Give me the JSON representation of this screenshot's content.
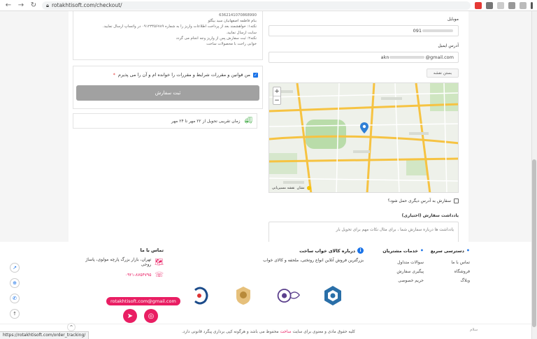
{
  "browser": {
    "url": "rotakhtisoft.com/checkout/"
  },
  "bank_info": {
    "lines": [
      "6362141070868990",
      "بنام فاطمه اصفهانیان سید بیگلو",
      "نکته۱: خواهشمند بعد از پرداخت اطلاعات واریز را به شماره ۰۹۱۲۳۴۵۶۷۸۹ در واتساپ ارسال نمایید.",
      "سایت ارسال نمایید.",
      "نکته۲: ثبت سفارش پس از واریز وجه انجام می گردد",
      "خوابی راحت با محصولات ساخت"
    ]
  },
  "terms": {
    "label": "من قوانین و مقررات شرایط و مقررات را خوانده ام و آن را می پذیرم",
    "required": "*",
    "order_button": "ثبت سفارش"
  },
  "delivery": {
    "text": "زمان تقریبی تحویل از ۲۲ مهر تا ۲۴ مهر"
  },
  "form": {
    "mobile_label": "موبایل",
    "mobile_value": "091",
    "email_label": "آدرس ایمیل",
    "email_prefix": "akn",
    "email_suffix": "@gmail.com",
    "close_map": "بستن نقشه",
    "map_credit": "نشان",
    "map_credit_sub": "نقشه مسیریابی",
    "zoom_in": "+",
    "zoom_out": "−",
    "other_address": "سفارش به آدرس دیگری حمل شود؟",
    "note_label": "یادداشت سفارش (اختیاری)",
    "note_placeholder": "یادداشت ها درباره سفارش شما ، برای مثال نکات مهم برای تحویل بار"
  },
  "footer": {
    "quick_access": {
      "title": "دسترسی سریع",
      "links": [
        "تماس با ما",
        "فروشگاه",
        "وبلاگ"
      ]
    },
    "customer_services": {
      "title": "خدمات مشتریان",
      "links": [
        "سوالات متداول",
        "پیگیری سفارش",
        "حریم خصوصی"
      ]
    },
    "about": {
      "title": "درباره کالای خواب ساخت",
      "text": "بزرگترین فروش آنلاین انواع روتختی، ملحفه و کالای خواب"
    },
    "contact": {
      "title": "تماس با ما",
      "address": "تهران، بازار بزرگ پارچه مولوی، پاساژ روحی",
      "phone": "۰۹۲۱-۸۷۵۴۷۹۵",
      "email": "rotakhtisoft.com@gmail.com"
    },
    "copyright_pre": "کلیه حقوق مادی و معنوی برای سایت",
    "copyright_brand": "ساخت",
    "copyright_post": "محفوظ می باشد و هرگونه کپی برداری پیگرد قانونی دارد.",
    "help": "سلام"
  },
  "status_url": "https://rotakhtisoft.com/order_tracking/"
}
